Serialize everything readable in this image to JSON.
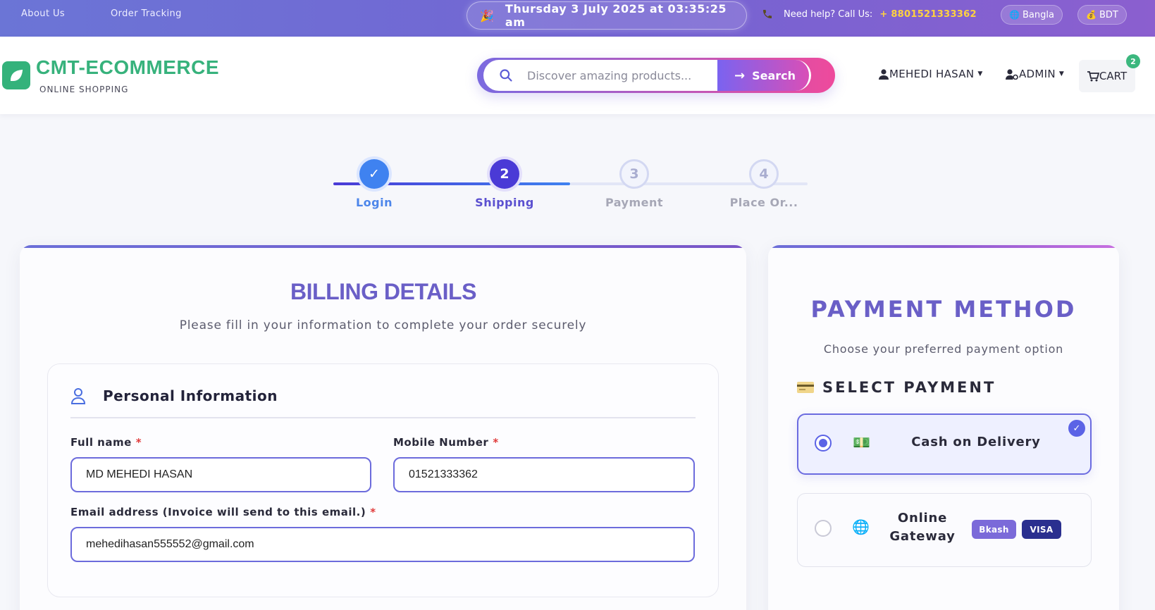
{
  "topbar": {
    "about": "About Us",
    "tracking": "Order Tracking",
    "datetime": "Thursday 3 July 2025 at 03:35:25 am",
    "help_label": "Need help? Call Us:",
    "help_number": "+ 8801521333362",
    "language": "Bangla",
    "currency": "BDT"
  },
  "header": {
    "brand": "CMT-ECOMMERCE",
    "tagline": "ONLINE SHOPPING",
    "search_placeholder": "Discover amazing products...",
    "search_button": "Search",
    "user_menu": "MEHEDI HASAN",
    "admin_menu": "ADMIN",
    "cart_label": "CART",
    "cart_count": "2"
  },
  "stepper": {
    "steps": [
      {
        "number": "✓",
        "label": "Login",
        "state": "done"
      },
      {
        "number": "2",
        "label": "Shipping",
        "state": "current"
      },
      {
        "number": "3",
        "label": "Payment",
        "state": "upcoming"
      },
      {
        "number": "4",
        "label": "Place Or...",
        "state": "upcoming"
      }
    ]
  },
  "billing": {
    "title": "BILLING DETAILS",
    "subtitle": "Please fill in your information to complete your order securely",
    "section_title": "Personal Information",
    "fields": {
      "full_name_label": "Full name",
      "full_name_value": "MD MEHEDI HASAN",
      "mobile_label": "Mobile Number",
      "mobile_value": "01521333362",
      "email_label": "Email address (Invoice will send to this email.)",
      "email_value": "mehedihasan555552@gmail.com",
      "required_mark": "*"
    }
  },
  "payment": {
    "title": "PAYMENT METHOD",
    "subtitle": "Choose your preferred payment option",
    "select_label": "SELECT PAYMENT",
    "options": [
      {
        "label": "Cash on Delivery",
        "selected": true
      },
      {
        "label_line1": "Online",
        "label_line2": "Gateway",
        "selected": false
      }
    ],
    "gateway_badges": [
      "Bkash",
      "VISA"
    ]
  },
  "colors": {
    "accent": "#6a5fc7",
    "brand_green": "#37b27c",
    "step_done": "#3f82f0",
    "step_current": "#4a3ad6",
    "bkash": "#7b6ad9",
    "visa": "#2a2f8f"
  }
}
